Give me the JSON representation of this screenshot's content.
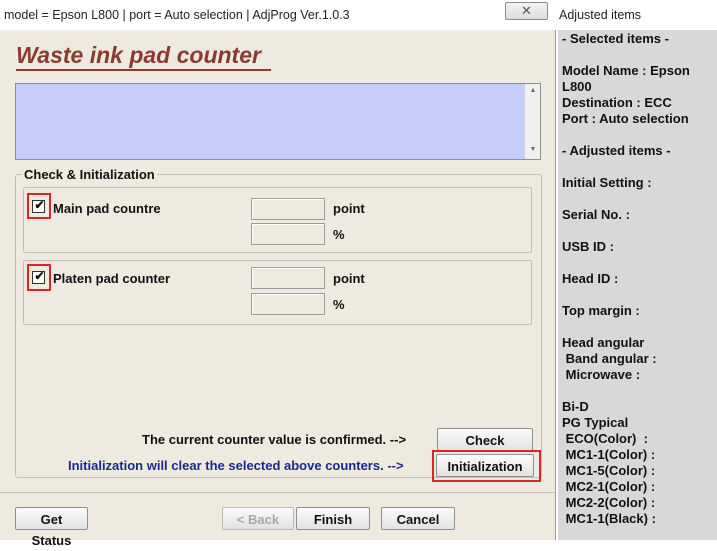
{
  "window": {
    "title": "model = Epson L800 | port = Auto selection | AdjProg Ver.1.0.3",
    "close_glyph": "✕"
  },
  "heading": "Waste ink pad counter",
  "group": {
    "title": "Check & Initialization",
    "main_pad": {
      "label": "Main pad countre",
      "checked": true,
      "point_value": "",
      "percent_value": "",
      "unit_point": "point",
      "unit_percent": "%"
    },
    "platen_pad": {
      "label": "Platen pad counter",
      "checked": true,
      "point_value": "",
      "percent_value": "",
      "unit_point": "point",
      "unit_percent": "%"
    },
    "check_text": "The current counter value is confirmed. -->",
    "check_button": "Check",
    "init_text": "Initialization will clear the selected above counters. -->",
    "init_button": "Initialization"
  },
  "footer": {
    "get_status": "Get Status",
    "back": "< Back",
    "finish": "Finish",
    "cancel": "Cancel"
  },
  "side_panel": {
    "title": "Adjusted items",
    "lines": [
      "- Selected items -",
      "Model Name : Epson",
      "L800",
      "Destination : ECC",
      "Port : Auto selection",
      "- Adjusted items -",
      "Initial Setting :",
      "Serial No. :",
      "USB ID :",
      "Head ID :",
      "Top margin :",
      "Head angular",
      " Band angular :",
      " Microwave :",
      "Bi-D",
      "PG Typical",
      " ECO(Color)  :",
      " MC1-1(Color) :",
      " MC1-5(Color) :",
      " MC2-1(Color) :",
      " MC2-2(Color) :",
      " MC1-1(Black) :"
    ]
  },
  "colors": {
    "heading": "#8b3a30",
    "message_area": "#c6cdfb",
    "highlight": "#d9262b",
    "init_text": "#1a2a8a"
  }
}
